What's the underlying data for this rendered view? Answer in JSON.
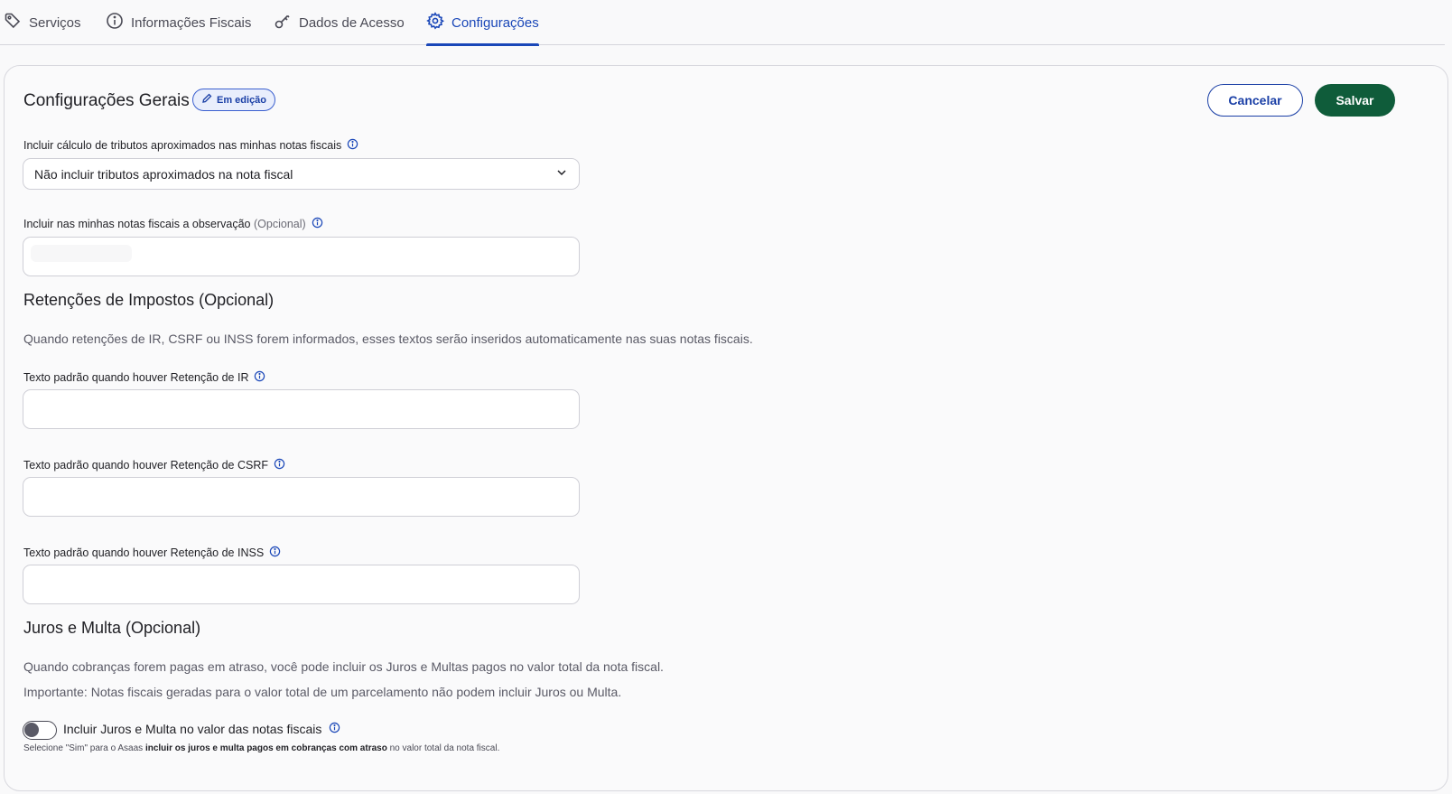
{
  "tabs": [
    {
      "label": "Serviços",
      "icon": "tag-icon"
    },
    {
      "label": "Informações Fiscais",
      "icon": "info-circle-icon"
    },
    {
      "label": "Dados de Acesso",
      "icon": "key-icon"
    },
    {
      "label": "Configurações",
      "icon": "gear-icon",
      "active": true
    }
  ],
  "header": {
    "title": "Configurações Gerais",
    "badge": "Em edição",
    "cancel_label": "Cancelar",
    "save_label": "Salvar"
  },
  "tributos": {
    "label": "Incluir cálculo de tributos aproximados nas minhas notas fiscais",
    "selected": "Não incluir tributos aproximados na nota fiscal"
  },
  "observacao": {
    "label": "Incluir nas minhas notas fiscais a observação",
    "optional": "(Opcional)",
    "value": ""
  },
  "retencoes": {
    "title": "Retenções de Impostos (Opcional)",
    "description": "Quando retenções de IR, CSRF ou INSS forem informados, esses textos serão inseridos automaticamente nas suas notas fiscais.",
    "ir_label": "Texto padrão quando houver Retenção de IR",
    "csrf_label": "Texto padrão quando houver Retenção de CSRF",
    "inss_label": "Texto padrão quando houver Retenção de INSS"
  },
  "juros": {
    "title": "Juros e Multa (Opcional)",
    "description": "Quando cobranças forem pagas em atraso, você pode incluir os Juros e Multas pagos no valor total da nota fiscal.",
    "important": "Importante: Notas fiscais geradas para o valor total de um parcelamento não podem incluir Juros ou Multa.",
    "toggle_label": "Incluir Juros e Multa no valor das notas fiscais",
    "toggle_on": false,
    "help_prefix": "Selecione \"Sim\" para o Asaas ",
    "help_bold": "incluir os juros e multa pagos em cobranças com atraso",
    "help_suffix": " no valor total da nota fiscal."
  },
  "colors": {
    "accent": "#1a47b8",
    "save_button": "#0f5c3a"
  }
}
